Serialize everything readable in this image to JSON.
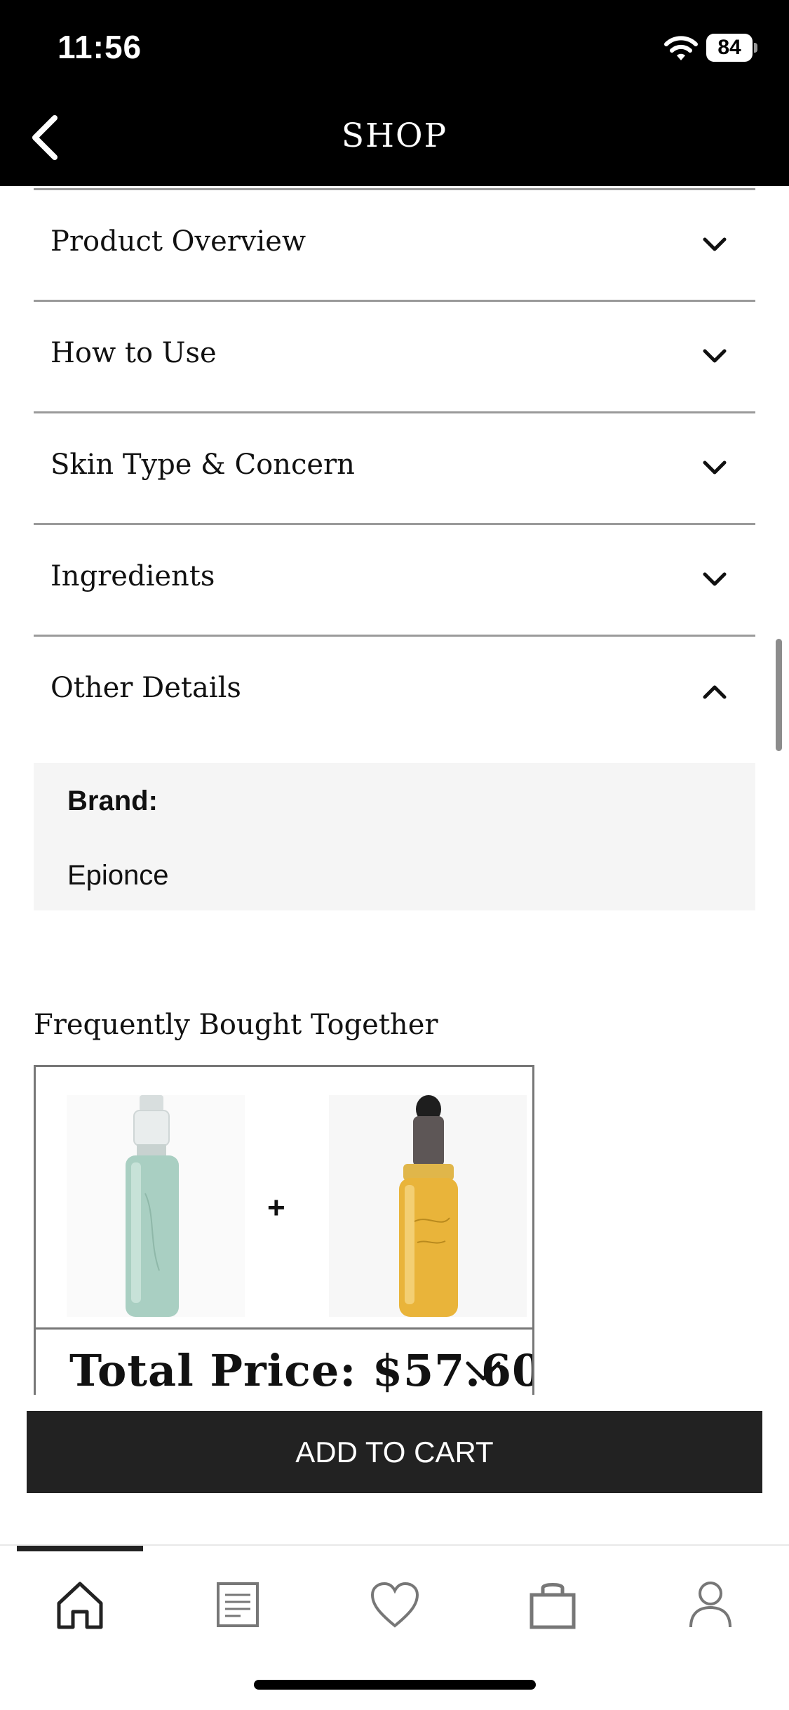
{
  "status_bar": {
    "time": "11:56",
    "battery": "84"
  },
  "header": {
    "title": "SHOP"
  },
  "accordion": {
    "items": [
      {
        "label": "Product Overview"
      },
      {
        "label": "How to Use"
      },
      {
        "label": "Skin Type & Concern"
      },
      {
        "label": "Ingredients"
      },
      {
        "label": "Other Details"
      }
    ],
    "details": {
      "key": "Brand:",
      "value": "Epionce"
    }
  },
  "fbt": {
    "title": "Frequently Bought Together",
    "plus": "+",
    "total_price": "Total Price: $57.60"
  },
  "cart": {
    "label": "ADD TO CART"
  },
  "colors": {
    "header_bg": "#000000",
    "button_bg": "#222222",
    "panel_bg": "#f5f5f5"
  },
  "tabs": [
    {
      "icon": "home-icon"
    },
    {
      "icon": "document-icon"
    },
    {
      "icon": "heart-icon"
    },
    {
      "icon": "bag-icon"
    },
    {
      "icon": "profile-icon"
    }
  ]
}
